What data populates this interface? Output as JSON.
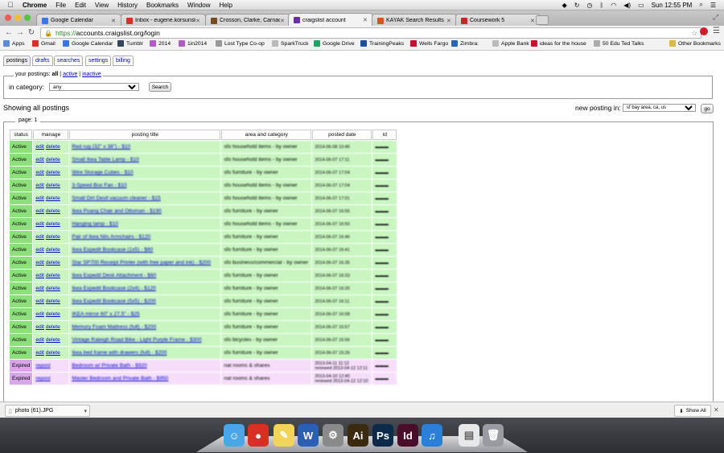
{
  "menubar": {
    "app": "Chrome",
    "menus": [
      "File",
      "Edit",
      "View",
      "History",
      "Bookmarks",
      "Window",
      "Help"
    ],
    "clock": "Sun 12:55 PM"
  },
  "tabs": [
    {
      "title": "Google Calendar",
      "color": "#3b78e7"
    },
    {
      "title": "Inbox - eugene.korsunski",
      "color": "#d93025"
    },
    {
      "title": "Crosson, Clarke, Carnach",
      "color": "#7a4b1e"
    },
    {
      "title": "craigslist account",
      "color": "#6a2fa8",
      "active": true
    },
    {
      "title": "KAYAK Search Results",
      "color": "#e0501e"
    },
    {
      "title": "Coursework 5",
      "color": "#c62828"
    }
  ],
  "url": {
    "scheme": "https://",
    "rest": "accounts.craigslist.org/login"
  },
  "bookmarks": [
    {
      "label": "Apps",
      "color": "#5a8ad8"
    },
    {
      "label": "Gmail",
      "color": "#d93025"
    },
    {
      "label": "Google Calendar",
      "color": "#3b78e7"
    },
    {
      "label": "Tumblr",
      "color": "#35465c"
    },
    {
      "label": "2014",
      "color": "#b25ac8"
    },
    {
      "label": "1in2014",
      "color": "#b25ac8"
    },
    {
      "label": "Lost Type Co-op",
      "color": "#999999"
    },
    {
      "label": "SparkTruck",
      "color": "#bbbbbb"
    },
    {
      "label": "Google Drive",
      "color": "#1fa463"
    },
    {
      "label": "TrainingPeaks",
      "color": "#1a4fa0"
    },
    {
      "label": "Wells Fargo",
      "color": "#c8102e"
    },
    {
      "label": "Zimbra:",
      "color": "#2a66b3"
    },
    {
      "label": "Apple Bank",
      "color": "#bbbbbb"
    },
    {
      "label": "ideas for the house",
      "color": "#c8102e"
    },
    {
      "label": "50 Edu Ted Talks",
      "color": "#aaaaaa"
    },
    {
      "label": "Other Bookmarks",
      "color": "#d9b84a"
    }
  ],
  "subtabs": [
    "postings",
    "drafts",
    "searches",
    "settings",
    "billing"
  ],
  "filter": {
    "legend_prefix": "your postings:",
    "all": "all",
    "active": "active",
    "inactive": "inactive",
    "category_label": "in category:",
    "category_value": "any",
    "search_button": "Search"
  },
  "showing": "Showing all postings",
  "new_posting_label": "new posting in:",
  "new_posting_area": "sf bay area, ca, us",
  "go_button": "go",
  "page_legend": "page: 1",
  "columns": [
    "status",
    "manage",
    "posting title",
    "area and category",
    "posted date",
    "id"
  ],
  "rows": [
    {
      "status": "Active",
      "title": "Red rug (32\" x 38\") - $10",
      "area": "sfo household items - by owner",
      "date": "2014-06-08 10:46",
      "kind": "active"
    },
    {
      "status": "Active",
      "title": "Small Ikea Table Lamp - $10",
      "area": "sfo household items - by owner",
      "date": "2014-06-07 17:11",
      "kind": "active"
    },
    {
      "status": "Active",
      "title": "Wire Storage Cubes - $10",
      "area": "sfo furniture - by owner",
      "date": "2014-06-07 17:04",
      "kind": "active"
    },
    {
      "status": "Active",
      "title": "3-Speed Box Fan - $10",
      "area": "sfo household items - by owner",
      "date": "2014-06-07 17:04",
      "kind": "active"
    },
    {
      "status": "Active",
      "title": "Small Dirt Devil vacuum cleaner - $15",
      "area": "sfo household items - by owner",
      "date": "2014-06-07 17:01",
      "kind": "active"
    },
    {
      "status": "Active",
      "title": "Ikea Poang Chair and Ottoman - $190",
      "area": "sfo furniture - by owner",
      "date": "2014-06-07 16:55",
      "kind": "active"
    },
    {
      "status": "Active",
      "title": "Hanging lamp - $10",
      "area": "sfo household items - by owner",
      "date": "2014-06-07 16:50",
      "kind": "active"
    },
    {
      "status": "Active",
      "title": "Pair of Ikea Nils Armchairs - $120",
      "area": "sfo furniture - by owner",
      "date": "2014-06-07 16:46",
      "kind": "active"
    },
    {
      "status": "Active",
      "title": "Ikea Expedit Bookcase (1x5) - $60",
      "area": "sfo furniture - by owner",
      "date": "2014-06-07 16:41",
      "kind": "active"
    },
    {
      "status": "Active",
      "title": "Star SP700 Receipt Printer (with free paper and ink) - $200",
      "area": "sfo business/commercial - by owner",
      "date": "2014-06-07 16:35",
      "kind": "active"
    },
    {
      "status": "Active",
      "title": "Ikea Expedit Desk Attachment - $60",
      "area": "sfo furniture - by owner",
      "date": "2014-06-07 16:33",
      "kind": "active"
    },
    {
      "status": "Active",
      "title": "Ikea Expedit Bookcase (2x4) - $120",
      "area": "sfo furniture - by owner",
      "date": "2014-06-07 16:20",
      "kind": "active"
    },
    {
      "status": "Active",
      "title": "Ikea Expedit Bookcase (5x5) - $200",
      "area": "sfo furniture - by owner",
      "date": "2014-06-07 16:11",
      "kind": "active"
    },
    {
      "status": "Active",
      "title": "IKEA mirror 60\" x 27.5\" - $25",
      "area": "sfo furniture - by owner",
      "date": "2014-06-07 16:08",
      "kind": "active"
    },
    {
      "status": "Active",
      "title": "Memory Foam Mattress (full) - $200",
      "area": "sfo furniture - by owner",
      "date": "2014-06-07 15:57",
      "kind": "active"
    },
    {
      "status": "Active",
      "title": "Vintage Raleigh Road Bike - Light Purple Frame - $300",
      "area": "sfo bicycles - by owner",
      "date": "2014-06-07 15:56",
      "kind": "active"
    },
    {
      "status": "Active",
      "title": "Ikea bed frame with drawers (full) - $200",
      "area": "sfo furniture - by owner",
      "date": "2014-06-07 15:26",
      "kind": "active"
    },
    {
      "status": "Expired",
      "title": "Bedroom w/ Private Bath - $920",
      "area": "nat rooms & shares",
      "date": "2013-04-11 11:12",
      "date2": "renewed 2013-04-12 12:11",
      "kind": "expired"
    },
    {
      "status": "Expired",
      "title": "Master Bedroom and Private Bath - $950",
      "area": "nat rooms & shares",
      "date": "2013-04-10 12:40",
      "date2": "renewed 2013-04-12 12:10",
      "kind": "expired"
    }
  ],
  "manage_edit": "edit",
  "manage_delete": "delete",
  "manage_repost": "repost",
  "download": {
    "file": "photo (61).JPG",
    "show_all": "Show All"
  },
  "dock": [
    {
      "name": "finder-icon",
      "color": "#4aa6e8",
      "glyph": "☺"
    },
    {
      "name": "chrome-icon",
      "color": "#d93025",
      "glyph": "●"
    },
    {
      "name": "stickies-icon",
      "color": "#f3d35a",
      "glyph": "✎"
    },
    {
      "name": "word-icon",
      "color": "#2b5fb5",
      "glyph": "W"
    },
    {
      "name": "system-preferences-icon",
      "color": "#8a8a8a",
      "glyph": "⚙"
    },
    {
      "name": "illustrator-icon",
      "color": "#3a2a10",
      "glyph": "Ai"
    },
    {
      "name": "photoshop-icon",
      "color": "#0d2a4a",
      "glyph": "Ps"
    },
    {
      "name": "indesign-icon",
      "color": "#4a0d2a",
      "glyph": "Id"
    },
    {
      "name": "itunes-icon",
      "color": "#2b7fd9",
      "glyph": "♫"
    },
    {
      "name": "pdf-document-icon",
      "color": "#e8e8e8",
      "glyph": "▤"
    },
    {
      "name": "trash-icon",
      "color": "#9a9aa2",
      "glyph": "🗑"
    }
  ]
}
